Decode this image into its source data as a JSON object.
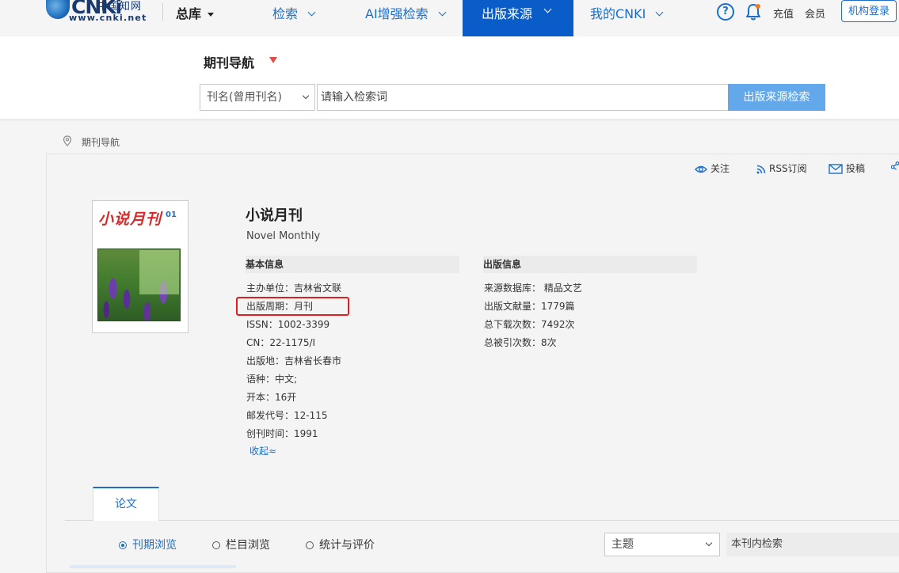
{
  "header": {
    "logo_cn": "中国知网",
    "logo_url": "www.cnki.net",
    "library_label": "总库",
    "nav": [
      {
        "label": "检索"
      },
      {
        "label": "AI增强检索"
      },
      {
        "label": "出版来源"
      },
      {
        "label": "我的CNKI"
      }
    ],
    "help_icon": "?",
    "recharge_label": "充值",
    "member_label": "会员",
    "login_label": "机构登录",
    "accent_color": "#0a5dc9"
  },
  "search": {
    "section_title": "期刊导航",
    "field_select": "刊名(曾用刊名)",
    "placeholder": "请输入检索词",
    "button_label": "出版来源检索"
  },
  "breadcrumb": {
    "label": "期刊导航"
  },
  "toolbar": {
    "follow_label": "关注",
    "rss_label": "RSS订阅",
    "submit_label": "投稿"
  },
  "journal": {
    "cover_title": "小说月刊",
    "cover_issue": "01",
    "title": "小说月刊",
    "english_title": "Novel Monthly",
    "basic_header": "基本信息",
    "publish_header": "出版信息",
    "basic_info": [
      "主办单位：吉林省文联",
      "出版周期：月刊",
      "ISSN：1002-3399",
      "CN：22-1175/I",
      "出版地：吉林省长春市",
      "语种：中文;",
      "开本：16开",
      "邮发代号：12-115",
      "创刊时间：1991"
    ],
    "publish_info": [
      "来源数据库： 精品文艺",
      "出版文献量：1779篇",
      "总下载次数：7492次",
      "总被引次数：8次"
    ],
    "collapse_label": "收起≈"
  },
  "tabs": {
    "papers_label": "论文"
  },
  "browse": {
    "options": [
      {
        "label": "刊期浏览",
        "selected": true
      },
      {
        "label": "栏目浏览",
        "selected": false
      },
      {
        "label": "统计与评价",
        "selected": false
      }
    ],
    "topic_select": "主题",
    "in_journal_search": "本刊内检索"
  }
}
